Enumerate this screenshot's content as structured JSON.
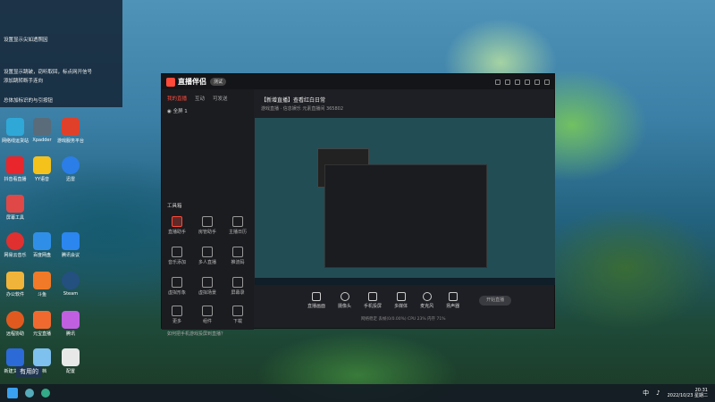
{
  "desktop": {
    "notifications": [
      {
        "text": "设置显示尖如透照因"
      },
      {
        "text": "设置显示跳破，窃听取回，标点网开信号"
      },
      {
        "text": "添加跳转断手连向"
      },
      {
        "text": "总体加标识的与引按钮"
      }
    ],
    "icons": [
      {
        "label": "网络线运货站",
        "color": "#2fa8d8"
      },
      {
        "label": "Xpadder",
        "color": "#5a6c7a"
      },
      {
        "label": "游戏服务平台",
        "color": "#e0402a"
      },
      {
        "label": "抖音看直播",
        "color": "#e8262b"
      },
      {
        "label": "YY语音",
        "color": "#f5c21b"
      },
      {
        "label": "迅雷",
        "color": "#2b7ee8"
      },
      {
        "label": "屏幕工具",
        "color": "#e04848"
      },
      {
        "label": "网易云音乐",
        "color": "#e03030"
      },
      {
        "label": "百度网盘",
        "color": "#2f8fe8"
      },
      {
        "label": "腾讯会议",
        "color": "#2b86f0"
      },
      {
        "label": "办公软件",
        "color": "#f0b43a"
      },
      {
        "label": "斗鱼",
        "color": "#f07a28"
      },
      {
        "label": "Steam",
        "color": "#245080"
      },
      {
        "label": "远程协助",
        "color": "#e05a20"
      },
      {
        "label": "元宝直播",
        "color": "#f06a30"
      },
      {
        "label": "腾讯",
        "color": "#c060e0"
      },
      {
        "label": "新建文件夹",
        "color": "#2c6ad8"
      },
      {
        "label": "文档",
        "color": "#7ec0ee"
      },
      {
        "label": "配置",
        "color": "#e8e8e8"
      }
    ],
    "watermark": "有用的"
  },
  "app": {
    "title": "直播伴侣",
    "badge": "测试",
    "tabs": [
      "我的直播",
      "互动",
      "可发送"
    ],
    "scene": "全屏 1",
    "tools_title": "工具箱",
    "tools": [
      {
        "label": "直播助手"
      },
      {
        "label": "房管助手"
      },
      {
        "label": "主播日历"
      },
      {
        "label": "音乐添加"
      },
      {
        "label": "多人直播"
      },
      {
        "label": "推流码"
      },
      {
        "label": "虚拟形象"
      },
      {
        "label": "虚拟场景"
      },
      {
        "label": "屏幕录"
      },
      {
        "label": "更多"
      },
      {
        "label": "组件"
      },
      {
        "label": "下载"
      }
    ],
    "bottom_tip": "如何把手机游戏投屏到直播？",
    "stream_title": "【新增直播】查看红白日常",
    "stream_sub": "游戏直播 · 信息娱乐  元素直播间  365802",
    "controls": [
      {
        "label": "直播画面"
      },
      {
        "label": "摄像头"
      },
      {
        "label": "手机投屏"
      },
      {
        "label": "多媒体"
      },
      {
        "label": "麦克风"
      },
      {
        "label": "扬声器"
      }
    ],
    "start_button": "开始直播",
    "status": "网络稳定  丢帧(0/0.00%)  CPU 23%  内存 71%"
  },
  "taskbar": {
    "time": "20:31",
    "date": "2022/10/23 星期二"
  }
}
